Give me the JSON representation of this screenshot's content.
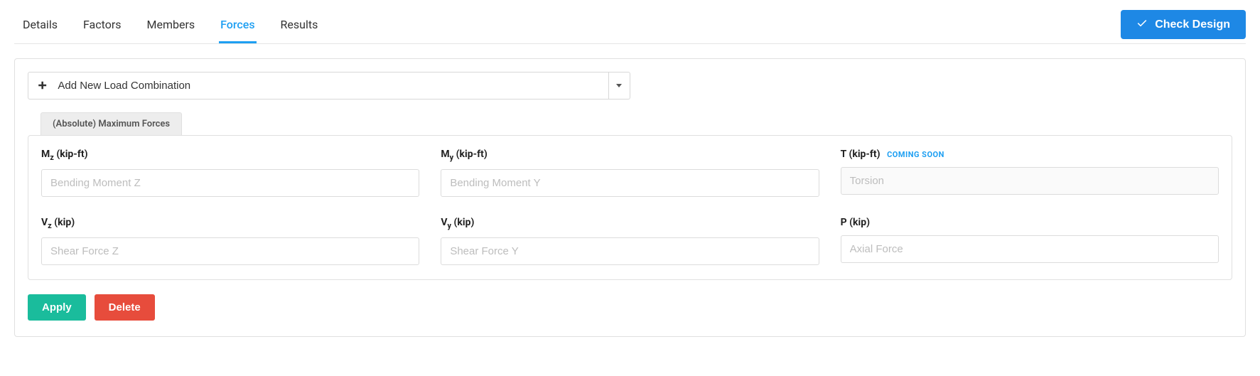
{
  "tabs": {
    "details": "Details",
    "factors": "Factors",
    "members": "Members",
    "forces": "Forces",
    "results": "Results",
    "active": "forces"
  },
  "header": {
    "check_design": "Check Design"
  },
  "combo": {
    "add_label": "Add New Load Combination"
  },
  "section": {
    "tab_label": "(Absolute) Maximum Forces"
  },
  "fields": {
    "mz": {
      "label_prefix": "M",
      "label_sub": "z",
      "label_unit": " (kip-ft)",
      "placeholder": "Bending Moment Z"
    },
    "my": {
      "label_prefix": "M",
      "label_sub": "y",
      "label_unit": " (kip-ft)",
      "placeholder": "Bending Moment Y"
    },
    "t": {
      "label": "T (kip-ft)",
      "placeholder": "Torsion",
      "badge": "Coming Soon"
    },
    "vz": {
      "label_prefix": "V",
      "label_sub": "z",
      "label_unit": " (kip)",
      "placeholder": "Shear Force Z"
    },
    "vy": {
      "label_prefix": "V",
      "label_sub": "y",
      "label_unit": " (kip)",
      "placeholder": "Shear Force Y"
    },
    "p": {
      "label": "P (kip)",
      "placeholder": "Axial Force"
    }
  },
  "actions": {
    "apply": "Apply",
    "delete": "Delete"
  }
}
